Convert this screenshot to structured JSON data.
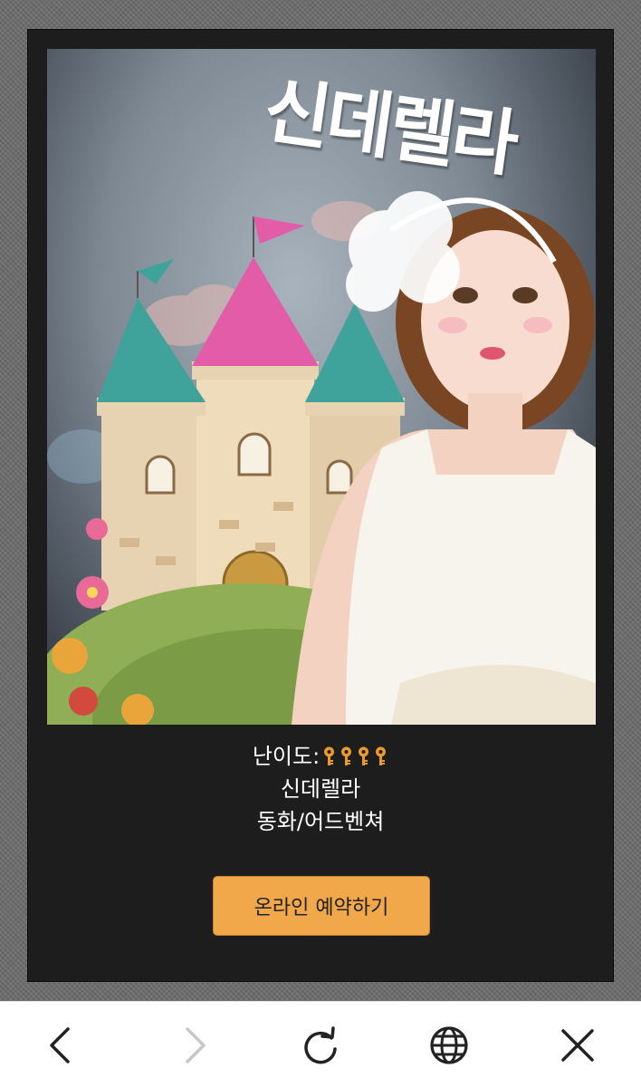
{
  "poster": {
    "title_art": "신데렐라"
  },
  "info": {
    "difficulty_label": "난이도:",
    "difficulty_keys": 4,
    "theme_name": "신데렐라",
    "genre": "동화/어드벤쳐"
  },
  "actions": {
    "reserve_label": "온라인 예약하기"
  },
  "browser": {
    "icons": [
      "back-icon",
      "forward-icon",
      "reload-icon",
      "globe-icon",
      "close-icon"
    ],
    "forward_disabled": true
  },
  "colors": {
    "button": "#f0a84a",
    "key": "#e89a2c",
    "card": "#1c1c1c"
  }
}
